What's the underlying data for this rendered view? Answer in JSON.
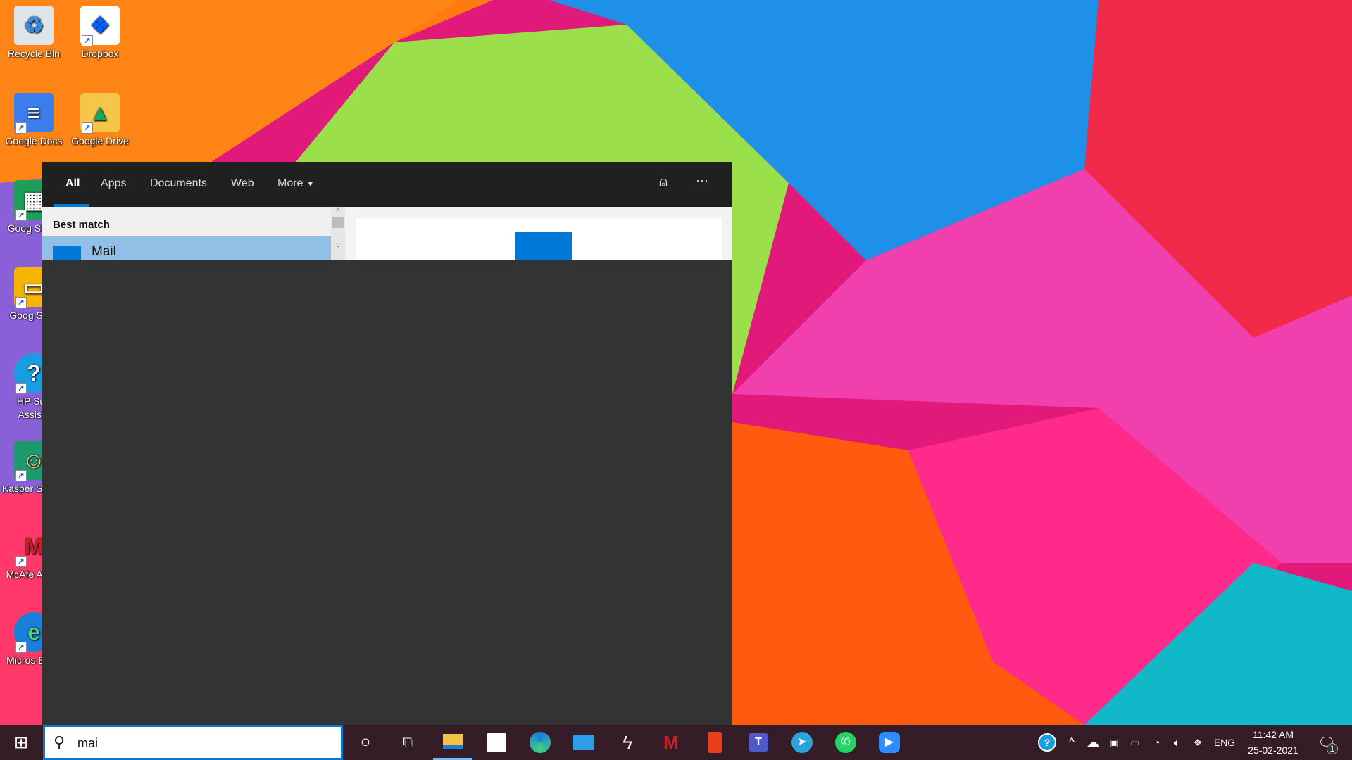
{
  "desktop": {
    "icons": [
      {
        "label": "Recycle Bin",
        "icon": "recycle-bin-icon"
      },
      {
        "label": "Dropbox",
        "icon": "dropbox-icon"
      },
      {
        "label": "Google Docs",
        "icon": "google-docs-icon"
      },
      {
        "label": "Google Drive",
        "icon": "google-drive-icon"
      },
      {
        "label": "Goog Sheet",
        "icon": "google-sheets-icon"
      },
      {
        "label": "Goog Slide",
        "icon": "google-slides-icon"
      },
      {
        "label": "HP Sup Assista",
        "icon": "hp-support-icon"
      },
      {
        "label": "Kasper Safe K",
        "icon": "kaspersky-icon"
      },
      {
        "label": "McAfe AntiVi",
        "icon": "mcafee-icon"
      },
      {
        "label": "Micros Edge",
        "icon": "edge-icon"
      }
    ]
  },
  "search_panel": {
    "tabs": [
      {
        "label": "All",
        "active": true
      },
      {
        "label": "Apps"
      },
      {
        "label": "Documents"
      },
      {
        "label": "Web"
      },
      {
        "label": "More"
      }
    ],
    "best_match_header": "Best match",
    "result": {
      "label": "Mail",
      "icon": "mail-icon"
    },
    "accent": "#0078d7"
  },
  "taskbar": {
    "search_value": "mai",
    "pinned": [
      "file-explorer",
      "microsoft-store",
      "edge",
      "mail",
      "app",
      "mcafee",
      "office",
      "teams",
      "telegram",
      "whatsapp",
      "zoom"
    ],
    "tray": {
      "language": "ENG",
      "time": "11:42 AM",
      "date": "25-02-2021",
      "notification_count": "1"
    }
  }
}
